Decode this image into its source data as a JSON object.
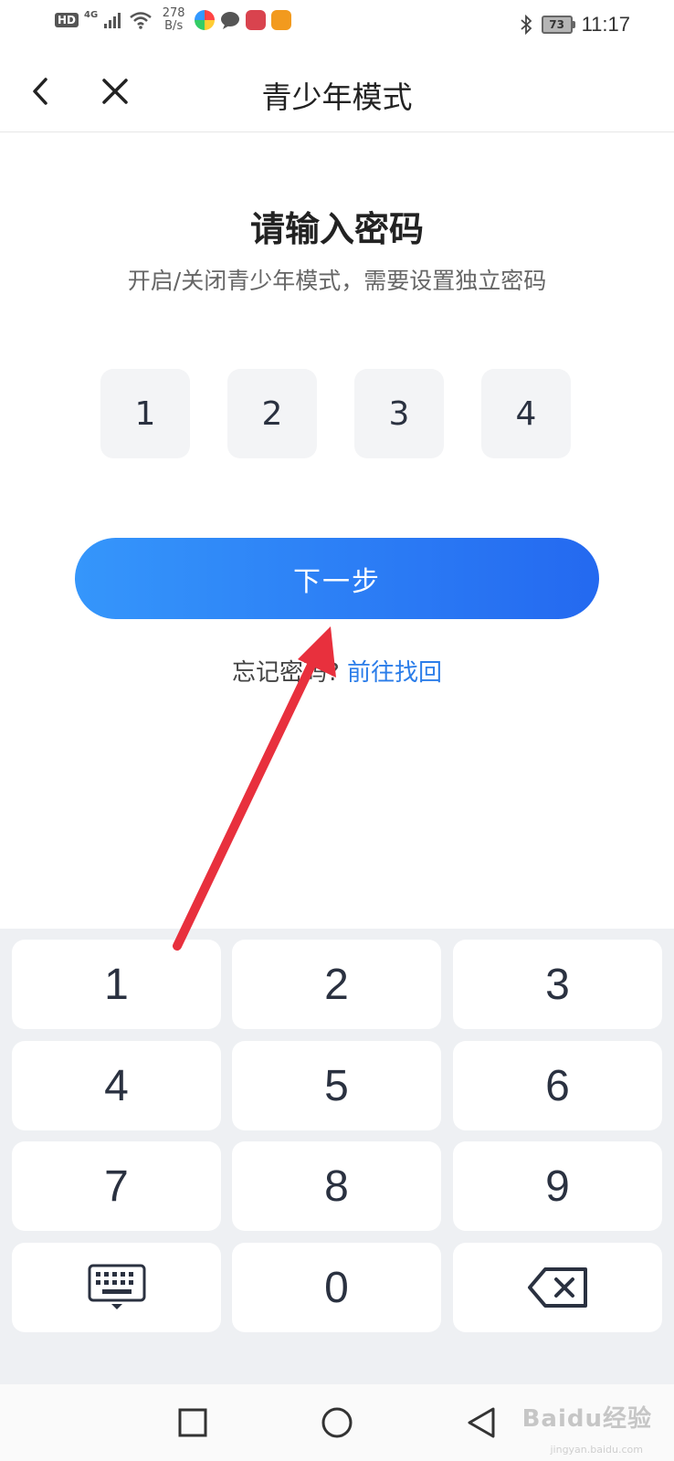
{
  "status_bar": {
    "hd": "HD",
    "network": "4G",
    "speed_value": "278",
    "speed_unit": "B/s",
    "battery": "73",
    "time": "11:17",
    "icons": [
      "signal-icon",
      "wifi-icon",
      "app-colorful-icon",
      "chat-bubble-icon",
      "red-app-icon",
      "orange-play-icon",
      "bluetooth-icon",
      "battery-icon"
    ]
  },
  "header": {
    "title": "青少年模式",
    "back_icon": "chevron-left-icon",
    "close_icon": "close-icon"
  },
  "main": {
    "heading": "请输入密码",
    "subheading": "开启/关闭青少年模式，需要设置独立密码",
    "pin_digits": [
      "1",
      "2",
      "3",
      "4"
    ],
    "next_button": "下一步",
    "forgot_text": "忘记密码?",
    "forgot_link": "前往找回"
  },
  "keypad": {
    "keys": [
      "1",
      "2",
      "3",
      "4",
      "5",
      "6",
      "7",
      "8",
      "9",
      "",
      "0",
      ""
    ],
    "keyboard_icon": "keyboard-icon",
    "backspace_icon": "backspace-icon"
  },
  "system_nav": {
    "icons": [
      "recent-apps-square-icon",
      "home-circle-icon",
      "back-triangle-icon"
    ]
  },
  "watermark": {
    "text": "Baidu经验",
    "sub": "jingyan.baidu.com"
  },
  "colors": {
    "accent_start": "#3596fb",
    "accent_end": "#2469f0",
    "link": "#2b7de9",
    "annotation_arrow": "#e8303d",
    "keypad_bg": "#eef0f3"
  }
}
